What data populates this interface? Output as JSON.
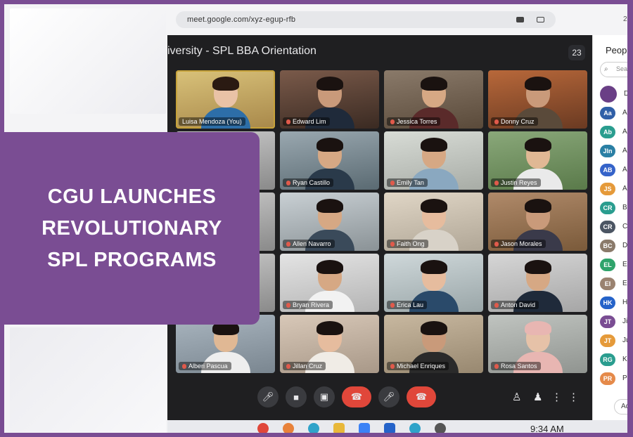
{
  "browser": {
    "url": "meet.google.com/xyz-egup-rfb",
    "corner_glyph": "2"
  },
  "meet": {
    "title": "iversity - SPL BBA Orientation",
    "participant_count": "23",
    "tiles": [
      {
        "name": "Luisa Mendoza (You)",
        "active": true
      },
      {
        "name": "Edward Lim"
      },
      {
        "name": "Jessica Torres"
      },
      {
        "name": "Donny Cruz"
      },
      {
        "name": ""
      },
      {
        "name": "Ryan Castillo"
      },
      {
        "name": "Emily Tan"
      },
      {
        "name": "Justin Reyes"
      },
      {
        "name": ""
      },
      {
        "name": "Allen Navarro"
      },
      {
        "name": "Faith Ong"
      },
      {
        "name": "Jason Morales"
      },
      {
        "name": ""
      },
      {
        "name": "Bryan Rivera"
      },
      {
        "name": "Erica Lau"
      },
      {
        "name": "Anton David"
      },
      {
        "name": "Alberi Pascua"
      },
      {
        "name": "Jillan Cruz"
      },
      {
        "name": "Michael Enriques"
      },
      {
        "name": "Rosa Santos"
      }
    ],
    "controls": {
      "mic_icon": "mic-icon",
      "camera_icon": "camera-icon",
      "present_icon": "present-icon",
      "hangup_icon": "hangup-icon"
    }
  },
  "people_panel": {
    "title": "People",
    "search_placeholder": "Search",
    "add_label": "Add",
    "rows": [
      {
        "badge": "",
        "name": "Dr",
        "color": "#6a3f86"
      },
      {
        "badge": "Aa",
        "name": "All",
        "color": "#2f5fa7"
      },
      {
        "badge": "Ab",
        "name": "Alv",
        "color": "#2a9d8f"
      },
      {
        "badge": "Jln",
        "name": "All",
        "color": "#2a7fa4"
      },
      {
        "badge": "AB",
        "name": "An",
        "color": "#3563c9"
      },
      {
        "badge": "JS",
        "name": "Ap",
        "color": "#e59a3a"
      },
      {
        "badge": "CR",
        "name": "Br",
        "color": "#2a9d8f"
      },
      {
        "badge": "CR",
        "name": "Ca",
        "color": "#4b5563"
      },
      {
        "badge": "BC",
        "name": "Do",
        "color": "#8a7a6a"
      },
      {
        "badge": "EL",
        "name": "Ed",
        "color": "#2fa36b"
      },
      {
        "badge": "EI",
        "name": "Eri",
        "color": "#9a8270"
      },
      {
        "badge": "HK",
        "name": "Ha",
        "color": "#2563c9"
      },
      {
        "badge": "JT",
        "name": "Jill",
        "color": "#7a4d93"
      },
      {
        "badge": "JT",
        "name": "Ju",
        "color": "#e59a3a"
      },
      {
        "badge": "RG",
        "name": "Ke",
        "color": "#2a9d8f"
      },
      {
        "badge": "PR",
        "name": "Pa",
        "color": "#e58a4a"
      }
    ]
  },
  "taskbar": {
    "time": "9:34 AM"
  },
  "headline": {
    "line1": "CGU LAUNCHES",
    "line2": "REVOLUTIONARY",
    "line3": "SPL PROGRAMS"
  },
  "colors": {
    "brand_purple": "#7a4d93",
    "hangup_red": "#e0473a",
    "meet_bg": "#1f1f21"
  }
}
